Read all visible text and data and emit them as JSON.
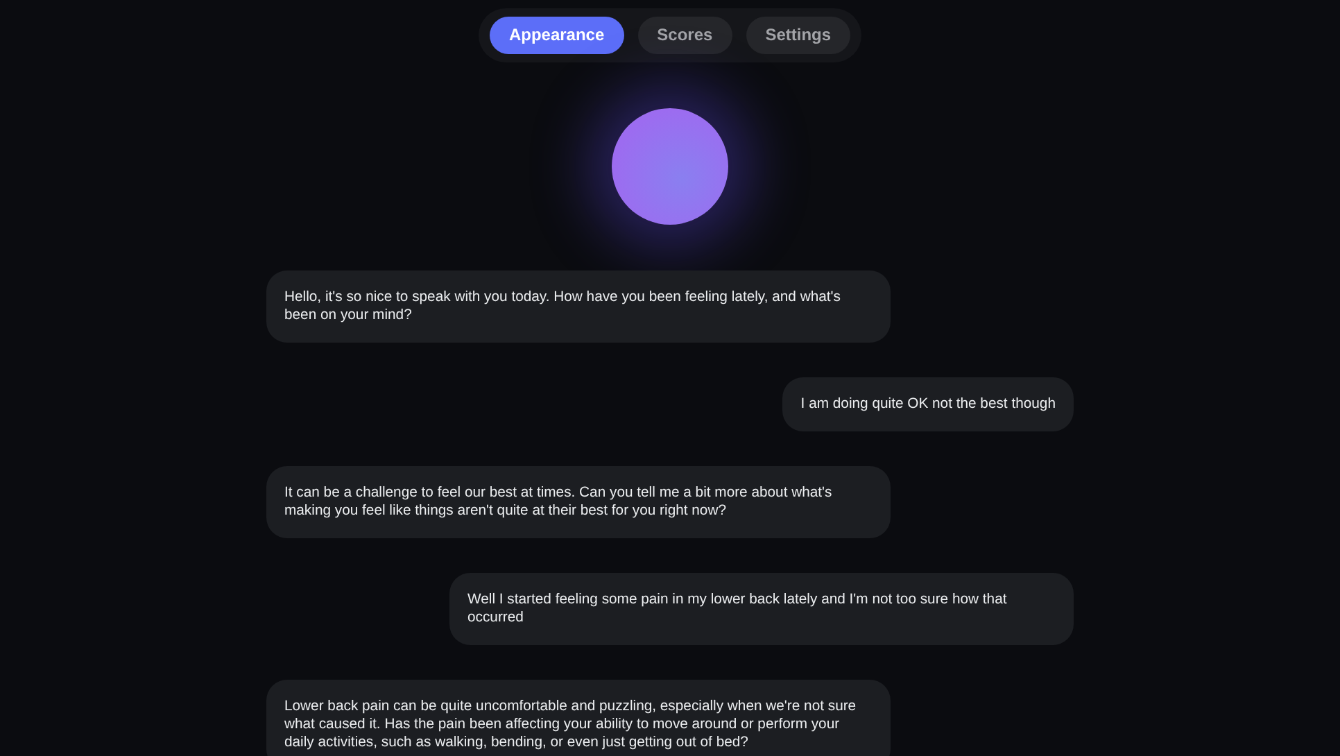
{
  "tabs": [
    {
      "label": "Appearance",
      "selected": true
    },
    {
      "label": "Scores",
      "selected": false
    },
    {
      "label": "Settings",
      "selected": false
    }
  ],
  "messages": [
    {
      "kind": "assistant",
      "text": "Hello, it's so nice to speak with you today. How have you been feeling lately, and what's been on your mind?"
    },
    {
      "kind": "user",
      "text": "I am doing quite OK not the best though"
    },
    {
      "kind": "assistant",
      "text": "It can be a challenge to feel our best at times. Can you tell me a bit more about what's making you feel like things aren't quite at their best for you right now?"
    },
    {
      "kind": "user",
      "text": "Well I started feeling some pain in my lower back lately and I'm not too sure how that occurred"
    },
    {
      "kind": "assistant",
      "text": "Lower back pain can be quite uncomfortable and puzzling, especially when we're not sure what caused it. Has the pain been affecting your ability to move around or perform your daily activities, such as walking, bending, or even just getting out of bed?"
    }
  ]
}
